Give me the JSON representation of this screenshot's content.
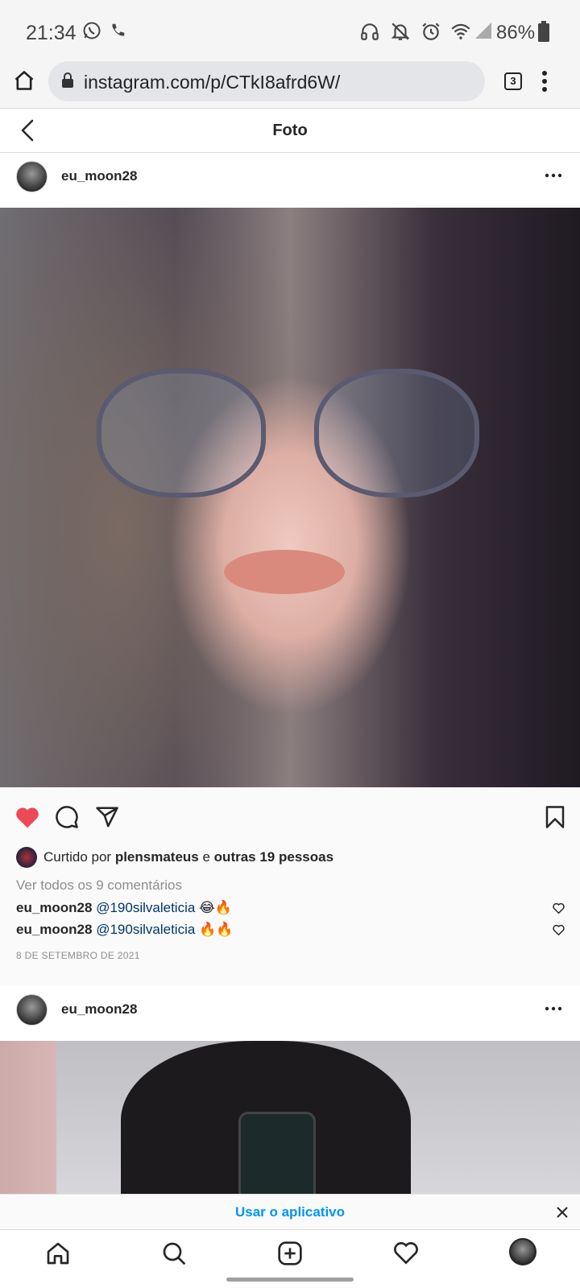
{
  "status_bar": {
    "time": "21:34",
    "battery": "86%",
    "icons": [
      "whatsapp-icon",
      "phone-icon",
      "headphones-icon",
      "bell-off-icon",
      "alarm-icon",
      "wifi-icon",
      "signal-icon",
      "battery-icon"
    ]
  },
  "browser": {
    "url": "instagram.com/p/CTkI8afrd6W/",
    "tab_count": "3"
  },
  "header": {
    "title": "Foto"
  },
  "post1": {
    "username": "eu_moon28",
    "liked_by_prefix": "Curtido por ",
    "liked_by_user": "plensmateus",
    "liked_by_middle": " e ",
    "liked_by_others": "outras 19 pessoas",
    "view_comments": "Ver todos os 9 comentários",
    "comments": [
      {
        "user": "eu_moon28",
        "mention": "@190silvaleticia",
        "emoji": " 😂🔥"
      },
      {
        "user": "eu_moon28",
        "mention": "@190silvaleticia",
        "emoji": " 🔥🔥"
      }
    ],
    "date": "8 DE SETEMBRO DE 2021",
    "liked": true
  },
  "post2": {
    "username": "eu_moon28"
  },
  "banner": {
    "label": "Usar o aplicativo"
  },
  "colors": {
    "like_red": "#ed4956",
    "link_blue": "#0095f6",
    "mention_blue": "#00376b"
  }
}
